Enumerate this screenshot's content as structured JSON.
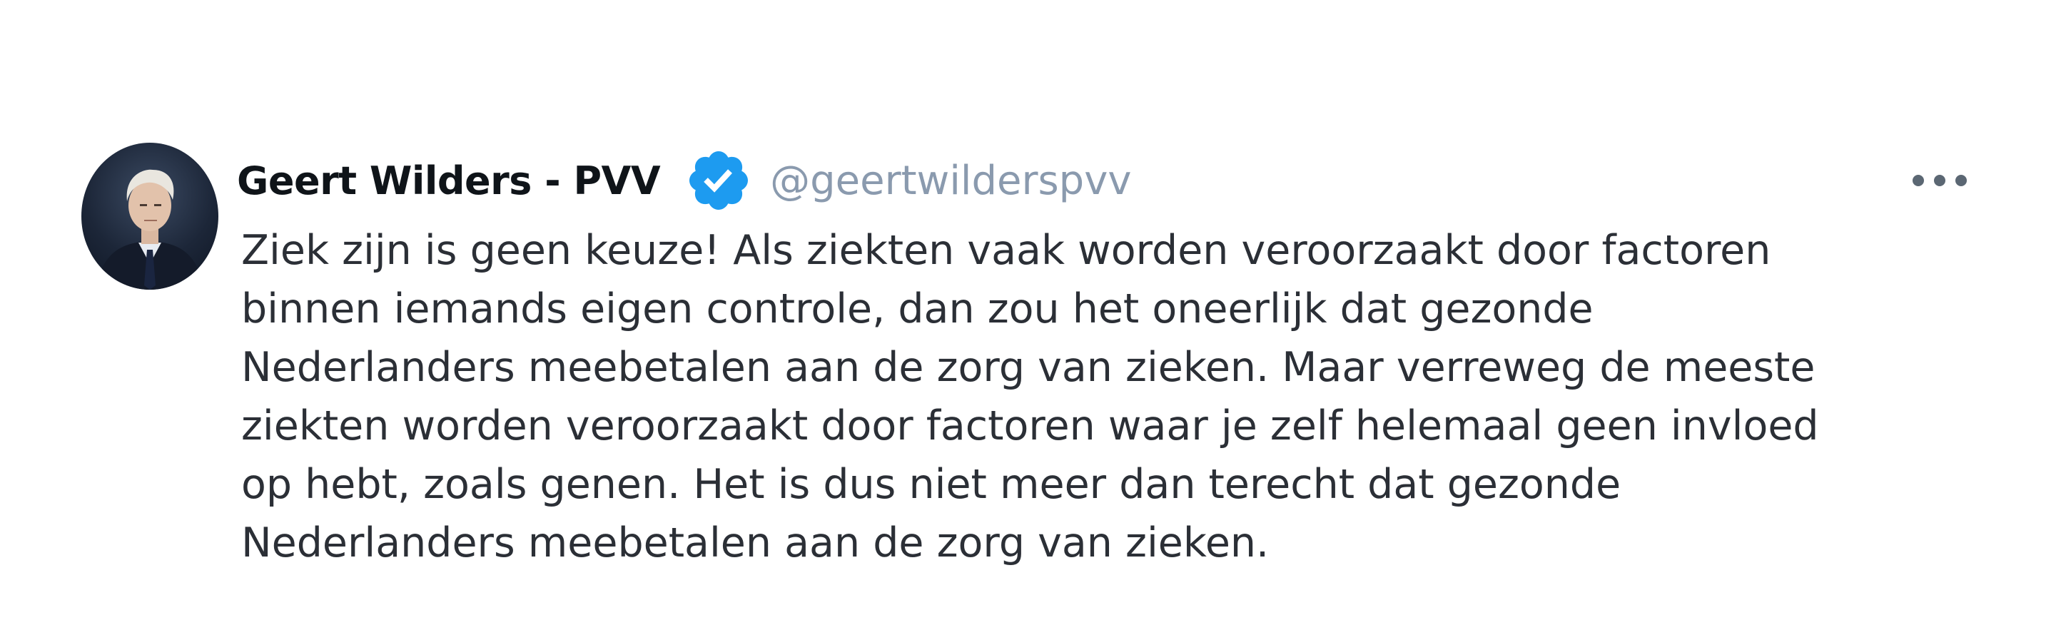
{
  "tweet": {
    "display_name": "Geert Wilders - PVV",
    "handle": "@geertwilderspvv",
    "verified_icon": "verified-badge-icon",
    "more_icon": "more-options-icon",
    "avatar_icon": "profile-avatar",
    "accent_color": "#1d9bf0",
    "text_lines": [
      "Ziek zijn is geen keuze! Als ziekten vaak worden veroorzaakt door factoren",
      "binnen iemands eigen controle, dan zou het oneerlijk dat gezonde",
      "Nederlanders meebetalen aan de zorg van zieken. Maar verreweg de meeste",
      "ziekten worden veroorzaakt door factoren waar je zelf helemaal geen invloed",
      "op hebt, zoals genen. Het is dus niet meer dan terecht dat gezonde",
      "Nederlanders meebetalen aan de zorg van zieken."
    ]
  }
}
